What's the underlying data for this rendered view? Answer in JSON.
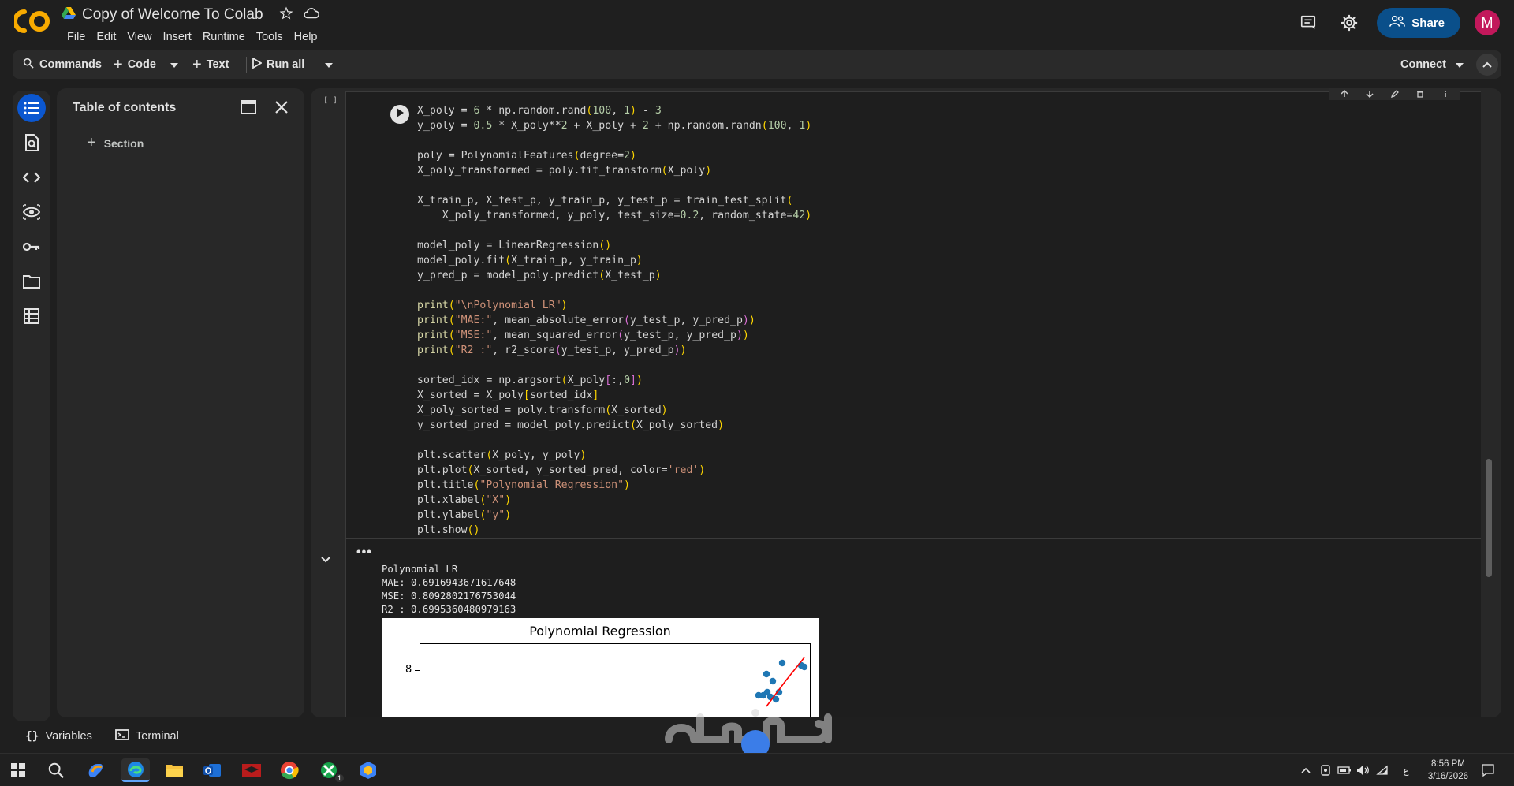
{
  "app": {
    "doc_title": "Copy of Welcome To Colab",
    "menu": [
      "File",
      "Edit",
      "View",
      "Insert",
      "Runtime",
      "Tools",
      "Help"
    ],
    "share_label": "Share",
    "avatar_letter": "M"
  },
  "toolbar": {
    "commands": "Commands",
    "code": "Code",
    "text": "Text",
    "run_all": "Run all",
    "connect": "Connect"
  },
  "toc": {
    "title": "Table of contents",
    "add_section": "Section"
  },
  "cell": {
    "bracket": "[ ]",
    "output_lines": [
      "Polynomial LR",
      "MAE: 0.6916943671617648",
      "MSE: 0.8092802176753044",
      "R2 : 0.6995360480979163"
    ]
  },
  "plot": {
    "title": "Polynomial Regression",
    "y_tick": "8"
  },
  "bottom": {
    "variables": "Variables",
    "terminal": "Terminal"
  },
  "taskbar": {
    "time": "8:56 PM",
    "date": "3/16/2026",
    "xbox_badge": "1",
    "lang": "ع"
  },
  "watermark": {
    "text": "mostaql.com"
  },
  "colors": {
    "keyword": "#c586c0",
    "string": "#ce9178",
    "number": "#b5cea8",
    "function": "#dcdcaa",
    "paren": "#ffd700",
    "scatter": "#1f77b4",
    "fit_line": "#ff0000"
  }
}
